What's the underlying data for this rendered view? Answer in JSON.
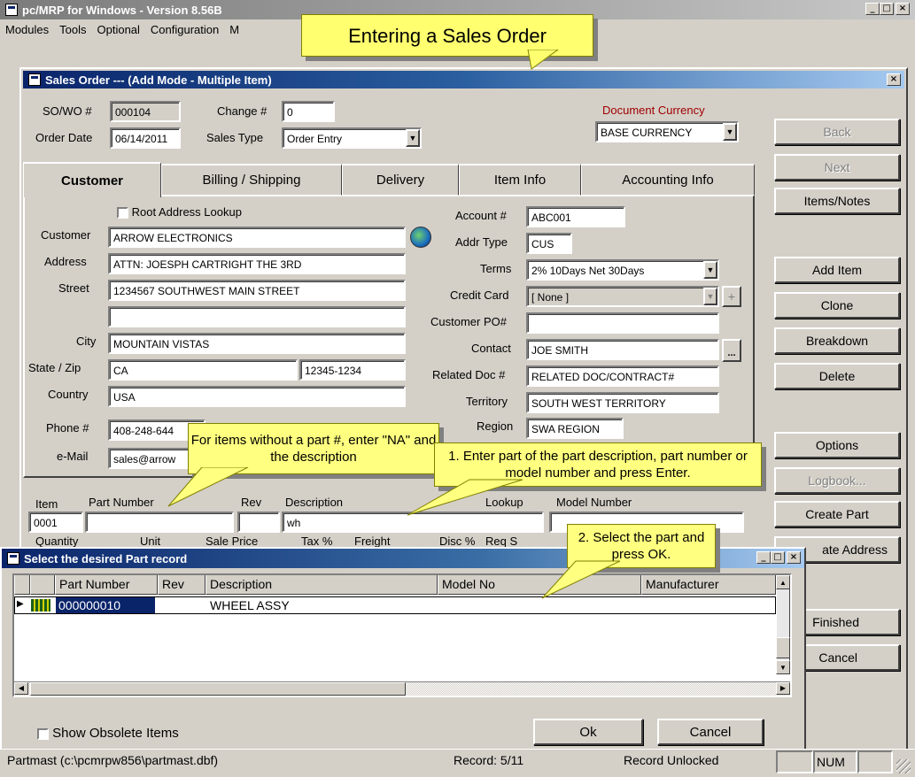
{
  "app": {
    "title": "pc/MRP for Windows - Version 8.56B",
    "menu": [
      "Modules",
      "Tools",
      "Optional",
      "Configuration",
      "M"
    ]
  },
  "banner": "Entering a Sales Order",
  "sales_order": {
    "title": "Sales Order --- (Add Mode - Multiple Item)",
    "sowo_label": "SO/WO #",
    "sowo_value": "000104",
    "change_label": "Change #",
    "change_value": "0",
    "order_date_label": "Order Date",
    "order_date_value": "06/14/2011",
    "sales_type_label": "Sales Type",
    "sales_type_value": "Order Entry",
    "doc_currency_label": "Document Currency",
    "doc_currency_value": "BASE CURRENCY",
    "tabs": [
      "Customer",
      "Billing / Shipping",
      "Delivery",
      "Item Info",
      "Accounting Info"
    ],
    "root_lookup_label": "Root Address Lookup",
    "customer_label": "Customer",
    "customer_value": "ARROW ELECTRONICS",
    "address_label": "Address",
    "address_value": "ATTN: JOESPH CARTRIGHT THE 3RD",
    "street_label": "Street",
    "street_value": "1234567 SOUTHWEST MAIN STREET",
    "street2_value": "",
    "city_label": "City",
    "city_value": "MOUNTAIN VISTAS",
    "statezip_label": "State / Zip",
    "state_value": "CA",
    "zip_value": "12345-1234",
    "country_label": "Country",
    "country_value": "USA",
    "phone_label": "Phone #",
    "phone_value": "408-248-644",
    "email_label": "e-Mail",
    "email_value": "sales@arrow",
    "account_label": "Account #",
    "account_value": "ABC001",
    "addrtype_label": "Addr Type",
    "addrtype_value": "CUS",
    "terms_label": "Terms",
    "terms_value": "2% 10Days Net 30Days",
    "credit_label": "Credit Card",
    "credit_value": "[ None ]",
    "custpo_label": "Customer PO#",
    "custpo_value": "",
    "contact_label": "Contact",
    "contact_value": "JOE SMITH",
    "relateddoc_label": "Related Doc #",
    "relateddoc_value": "RELATED DOC/CONTRACT#",
    "territory_label": "Territory",
    "territory_value": "SOUTH WEST TERRITORY",
    "region_label": "Region",
    "region_value": "SWA REGION",
    "item_label": "Item",
    "item_value": "0001",
    "partnum_label": "Part Number",
    "partnum_value": "",
    "rev_label": "Rev",
    "rev_value": "",
    "desc_label": "Description",
    "desc_value": "wh",
    "lookup_label": "Lookup",
    "model_label": "Model Number",
    "row2_labels": [
      "Quantity",
      "Unit",
      "Sale Price",
      "Tax %",
      "Freight",
      "Disc %",
      "Req S"
    ]
  },
  "side_buttons": {
    "back": "Back",
    "next": "Next",
    "items_notes": "Items/Notes",
    "add_item": "Add Item",
    "clone": "Clone",
    "breakdown": "Breakdown",
    "delete": "Delete",
    "options": "Options",
    "logbook": "Logbook...",
    "create_part": "Create Part",
    "create_address": "ate Address",
    "finished": "Finished",
    "cancel": "Cancel"
  },
  "callouts": {
    "na": "For items without a part #, enter \"NA\" and the description",
    "step1": "1.  Enter part of the part description, part number or model number and press Enter.",
    "step2": "2.  Select the part and press OK."
  },
  "part_dialog": {
    "title": "Select the desired Part record",
    "columns": [
      "Part Number",
      "Rev",
      "Description",
      "Model No",
      "Manufacturer"
    ],
    "rows": [
      {
        "part": "000000010",
        "rev": "",
        "description": "WHEEL ASSY",
        "model": "",
        "mfr": ""
      }
    ],
    "show_obsolete": "Show Obsolete Items",
    "ok": "Ok",
    "cancel": "Cancel"
  },
  "status": {
    "file": "Partmast (c:\\pcmrpw856\\partmast.dbf)",
    "record": "Record: 5/11",
    "lock": "Record Unlocked",
    "num": "NUM"
  },
  "colors": {
    "title_active": "#0a246a",
    "callout_bg": "#ffff80",
    "doc_currency_label": "#a00000",
    "selected_row": "#0a246a"
  }
}
